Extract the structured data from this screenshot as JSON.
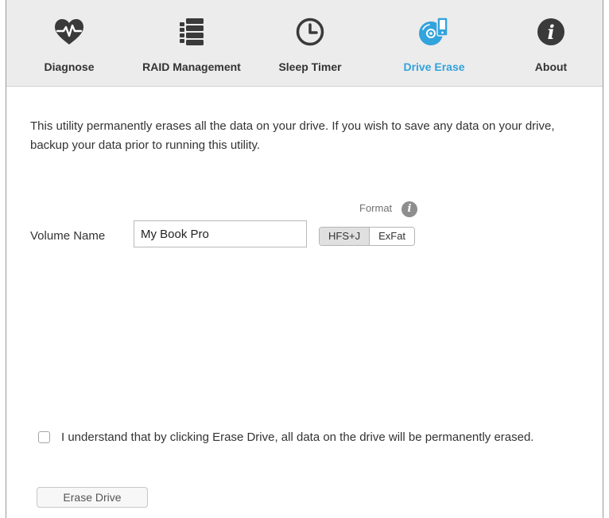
{
  "tabs": [
    {
      "label": "Diagnose",
      "icon": "heart-pulse-icon",
      "active": false
    },
    {
      "label": "RAID Management",
      "icon": "raid-stack-icon",
      "active": false
    },
    {
      "label": "Sleep Timer",
      "icon": "clock-icon",
      "active": false
    },
    {
      "label": "Drive Erase",
      "icon": "drive-erase-icon",
      "active": true
    },
    {
      "label": "About",
      "icon": "info-icon",
      "active": false
    }
  ],
  "colors": {
    "accent": "#31a3dd",
    "icon_dark": "#3a3a3a",
    "toolbar_bg": "#ececec"
  },
  "main": {
    "intro": "This utility permanently erases all the data on your drive. If you wish to save any data on your drive, backup your data prior to running this utility.",
    "format_label": "Format",
    "volume_label": "Volume Name",
    "volume_value": "My Book Pro",
    "format_options": [
      "HFS+J",
      "ExFat"
    ],
    "format_selected": "HFS+J",
    "confirm_text": "I understand that by clicking Erase Drive, all data on the drive will be permanently erased.",
    "confirm_checked": false,
    "erase_button": "Erase Drive"
  }
}
